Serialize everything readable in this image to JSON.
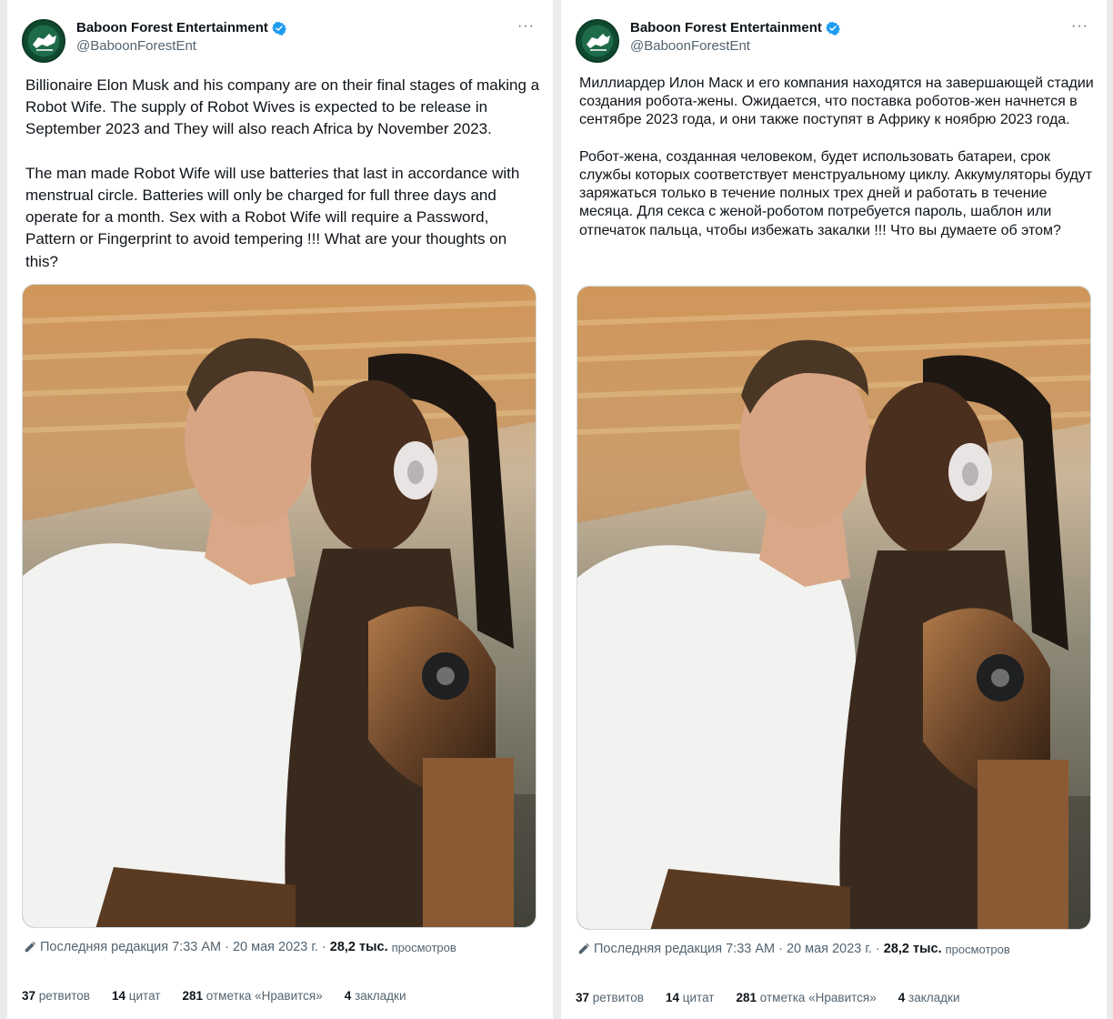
{
  "account": {
    "name": "Baboon Forest Entertainment",
    "handle": "@BaboonForestEnt",
    "more_label": "···",
    "verified_color": "#1d9bf0"
  },
  "left": {
    "text": "Billionaire Elon Musk and his company are on their final stages of making a Robot Wife. The supply of Robot Wives is expected to be release in September 2023 and They will also reach Africa by November 2023.\n\nThe man made Robot Wife will use batteries that last in accordance with menstrual circle. Batteries will only be charged for full three days and operate for a month. Sex with a Robot Wife will require a Password, Pattern or Fingerprint to avoid tempering !!! What are your thoughts on this?"
  },
  "right": {
    "text": "Миллиардер Илон Маск и его компания находятся на завершающей стадии создания робота-жены. Ожидается, что поставка роботов-жен начнется в сентябре 2023 года, и они также поступят в Африку к ноябрю 2023 года.\n\nРобот-жена, созданная человеком, будет использовать батареи, срок службы которых соответствует менструальному циклу. Аккумуляторы будут заряжаться только в течение полных трех дней и работать в течение месяца. Для секса с женой-роботом потребуется пароль, шаблон или отпечаток пальца, чтобы избежать закалки !!! Что вы думаете об этом?"
  },
  "meta": {
    "edit_icon": "pencil-icon",
    "edited_text": "Последняя редакция 7:33 AM · 20 мая 2023 г. ·",
    "views_count": "28,2 тыс.",
    "views_label": "просмотров"
  },
  "stats": [
    {
      "count": "37",
      "label": "ретвитов"
    },
    {
      "count": "14",
      "label": "цитат"
    },
    {
      "count": "281",
      "label": "отметка «Нравится»"
    },
    {
      "count": "4",
      "label": "закладки"
    }
  ]
}
